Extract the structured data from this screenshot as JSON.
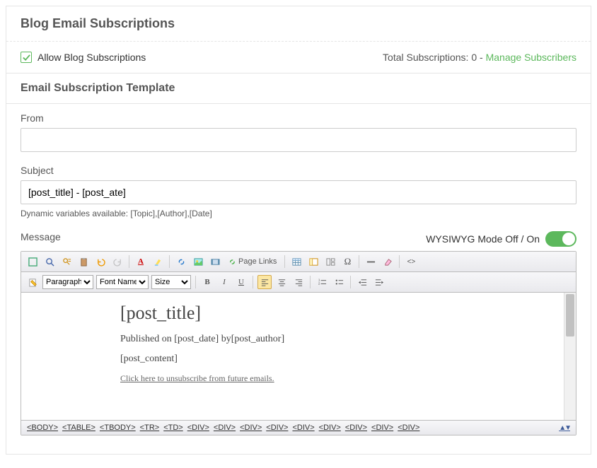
{
  "header": {
    "title": "Blog Email Subscriptions"
  },
  "allow": {
    "label": "Allow Blog Subscriptions",
    "checked": true,
    "total_label": "Total Subscriptions: ",
    "total_value": "0",
    "sep": " - ",
    "manage_link": "Manage Subscribers"
  },
  "template": {
    "header": "Email Subscription Template",
    "from_label": "From",
    "from_value": "",
    "subject_label": "Subject",
    "subject_value": "[post_title] - [post_ate]",
    "help": "Dynamic variables available: [Topic],[Author],[Date]",
    "message_label": "Message",
    "wysiwyg_label": "WYSIWYG Mode Off / On"
  },
  "toolbar": {
    "page_links_label": "Page Links",
    "paragraph": "Paragraph",
    "fontname": "Font Name",
    "size": "Size"
  },
  "content": {
    "title": "[post_title]",
    "published": "Published on [post_date] by[post_author]",
    "body": "[post_content]",
    "unsub": "Click here to unsubscribe from future emails."
  },
  "breadcrumb": [
    "<BODY>",
    "<TABLE>",
    "<TBODY>",
    "<TR>",
    "<TD>",
    "<DIV>",
    "<DIV>",
    "<DIV>",
    "<DIV>",
    "<DIV>",
    "<DIV>",
    "<DIV>",
    "<DIV>",
    "<DIV>"
  ]
}
